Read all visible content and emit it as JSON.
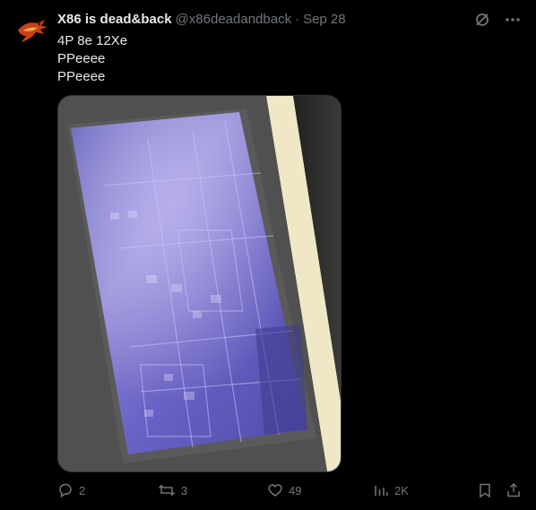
{
  "tweet": {
    "display_name": "X86 is dead&back",
    "handle": "@x86deadandback",
    "separator": "·",
    "date": "Sep 28",
    "lines": [
      "4P 8e 12Xe",
      "PPeeee",
      "PPeeee"
    ]
  },
  "media": {
    "icon": "chip-die-photo"
  },
  "actions": {
    "reply_count": "2",
    "repost_count": "3",
    "like_count": "49",
    "views_count": "2K"
  },
  "icons": {
    "grok": "grok-icon",
    "more": "more-icon",
    "reply": "reply-icon",
    "repost": "repost-icon",
    "like": "like-icon",
    "views": "views-icon",
    "bookmark": "bookmark-icon",
    "share": "share-icon"
  },
  "colors": {
    "background": "#000000",
    "text": "#e7e9ea",
    "muted": "#71767b"
  }
}
